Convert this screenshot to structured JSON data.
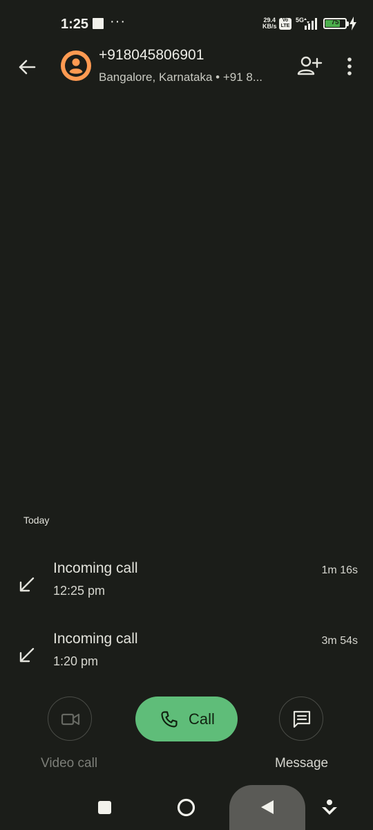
{
  "status_bar": {
    "time": "1:25",
    "more": "···",
    "net_speed_value": "29.4",
    "net_speed_unit": "KB/s",
    "volte_top": "Vo",
    "volte_bottom": "LTE",
    "network": "5G",
    "battery_level": "75",
    "battery_fraction": 0.75,
    "battery_color": "#4cae4c"
  },
  "header": {
    "contact_number": "+918045806901",
    "contact_subtitle": "Bangalore, Karnataka • +91 8..."
  },
  "call_history": {
    "section_label": "Today",
    "calls": [
      {
        "type": "Incoming call",
        "time": "12:25 pm",
        "duration": "1m 16s"
      },
      {
        "type": "Incoming call",
        "time": "1:20 pm",
        "duration": "3m 54s"
      }
    ]
  },
  "actions": {
    "video_call_label": "Video call",
    "call_label": "Call",
    "message_label": "Message",
    "call_color": "#5fbd79",
    "avatar_color": "#ff9a52"
  },
  "icons": {
    "back": "arrow-back-icon",
    "avatar": "person-icon",
    "add_contact": "person-add-icon",
    "more": "more-vert-icon",
    "incoming": "incoming-call-arrow-icon",
    "video": "videocam-icon",
    "phone": "phone-icon",
    "message": "message-icon"
  }
}
